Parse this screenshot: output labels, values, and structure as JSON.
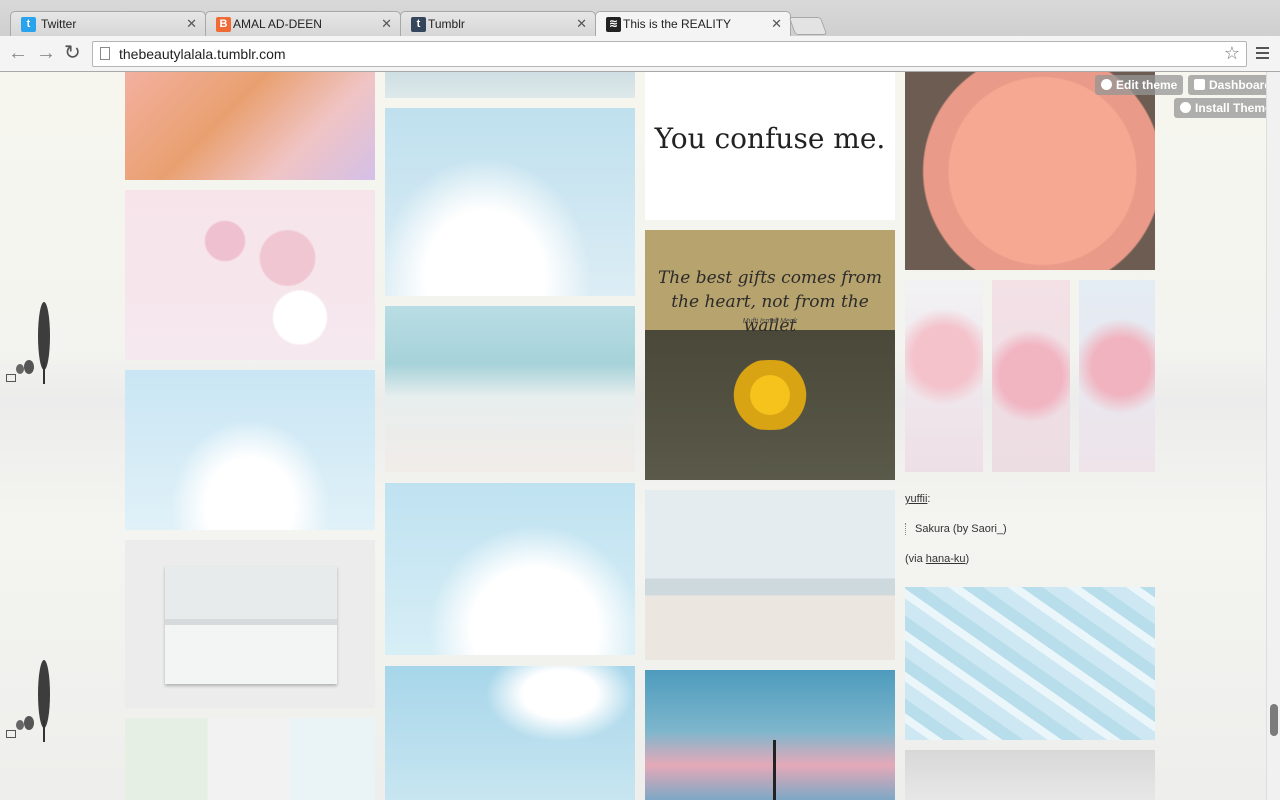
{
  "browser": {
    "tabs": [
      {
        "title": "Twitter",
        "icon": "twitter-icon",
        "color": "#2aa3ef"
      },
      {
        "title": "AMAL AD-DEEN",
        "icon": "blogger-icon",
        "color": "#f06a35"
      },
      {
        "title": "Tumblr",
        "icon": "tumblr-icon",
        "color": "#35465c"
      },
      {
        "title": "This is the REALITY",
        "icon": "site-icon",
        "color": "#222222"
      }
    ],
    "url": "thebeautylalala.tumblr.com"
  },
  "tumblr_controls": {
    "edit_theme": "Edit theme",
    "dashboard": "Dashboard",
    "install_theme": "Install Theme"
  },
  "posts": {
    "quote": "You confuse me.",
    "gift_quote": "The best gifts comes from the heart, not from the wallet",
    "gift_quote_sub": "Mufti Ismail Menk",
    "caption": {
      "user": "yuffii",
      "user_suffix": ":",
      "blockquote": "Sakura (by Saori_)",
      "via_prefix": "(via ",
      "via_user": "hana-ku",
      "via_suffix": ")"
    }
  }
}
